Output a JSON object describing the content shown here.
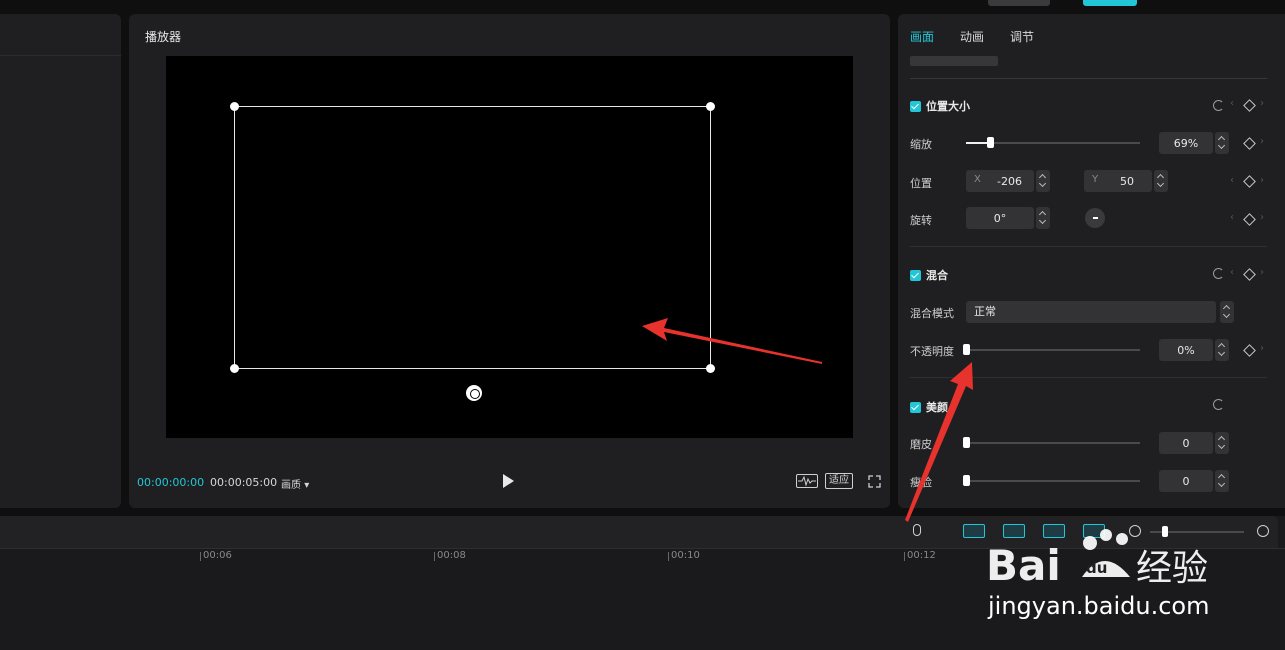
{
  "player": {
    "title": "播放器",
    "timecode_current": "00:00:00:00",
    "timecode_total": "00:00:05:00",
    "quality_label": "画质",
    "fit_label": "适应"
  },
  "inspector": {
    "tabs": [
      {
        "label": "画面",
        "active": true
      },
      {
        "label": "动画",
        "active": false
      },
      {
        "label": "调节",
        "active": false
      }
    ],
    "position_size": {
      "title": "位置大小",
      "scale_label": "缩放",
      "scale_value": "69%",
      "scale_fraction": 0.14,
      "position_label": "位置",
      "x_axis": "X",
      "x_value": "-206",
      "y_axis": "Y",
      "y_value": "50",
      "rotation_label": "旋转",
      "rotation_value": "0°"
    },
    "blend": {
      "title": "混合",
      "mode_label": "混合模式",
      "mode_value": "正常",
      "opacity_label": "不透明度",
      "opacity_value": "0%",
      "opacity_fraction": 0.0
    },
    "beauty": {
      "title": "美颜",
      "smooth_label": "磨皮",
      "smooth_value": "0",
      "face_label": "瘦脸",
      "face_value": "0"
    }
  },
  "timeline": {
    "ticks": [
      "00:06",
      "00:08",
      "00:10",
      "00:12"
    ]
  },
  "colors": {
    "accent": "#22c6d6",
    "annotation": "#e8322d"
  },
  "watermark": {
    "text": "jingyan.baidu.com"
  }
}
